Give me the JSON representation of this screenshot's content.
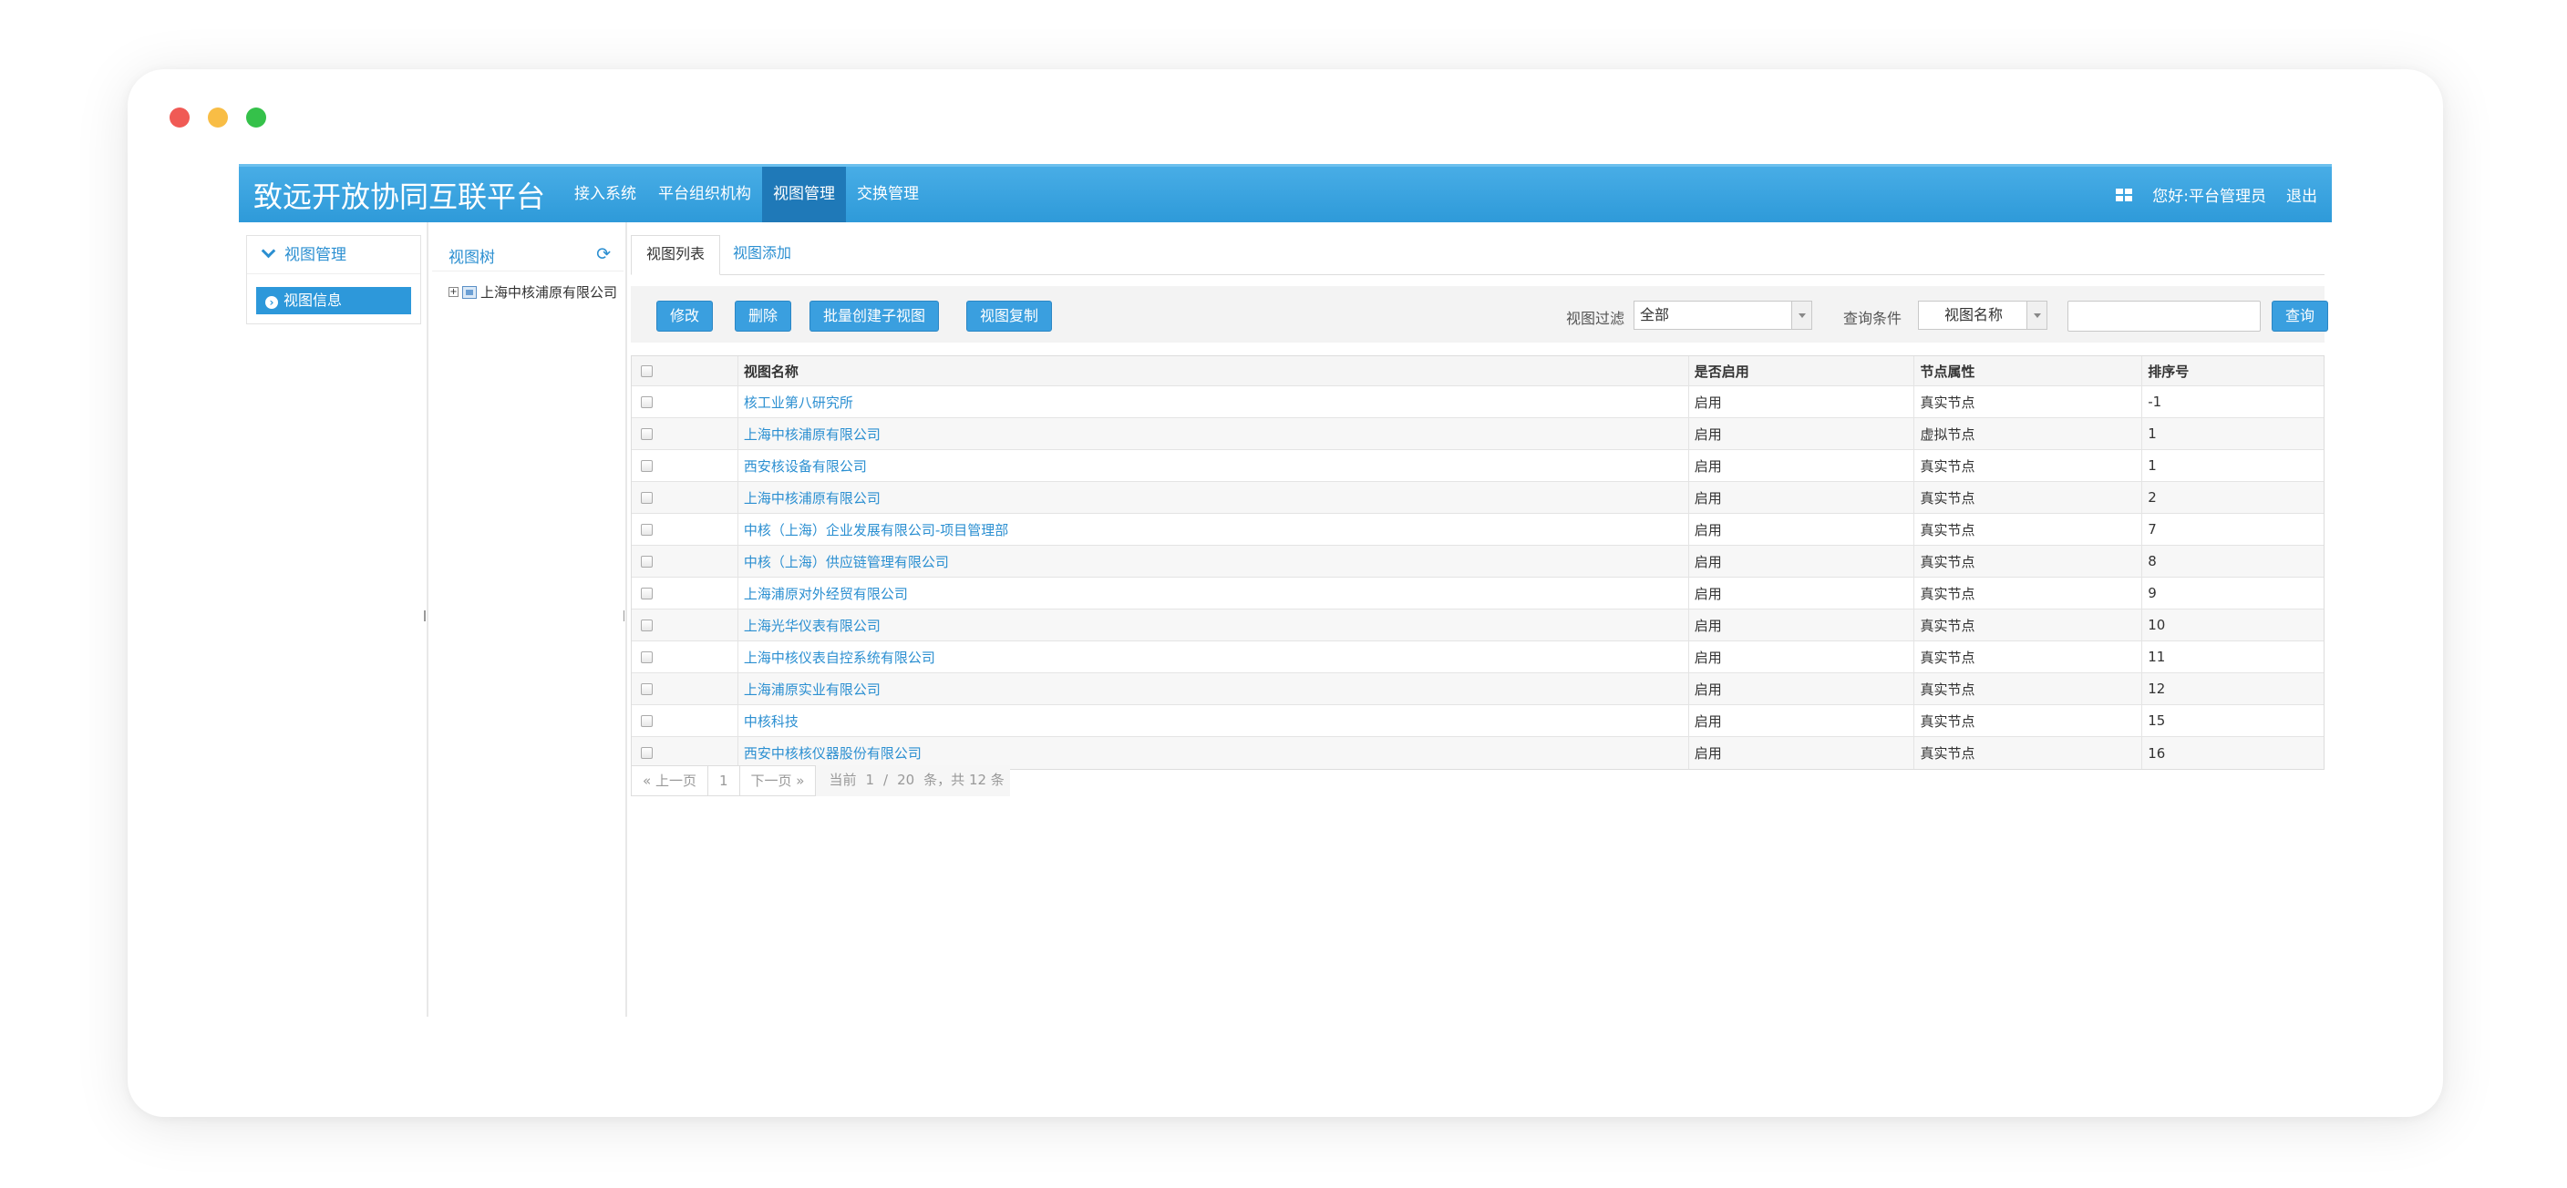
{
  "brand": "致远开放协同互联平台",
  "nav": [
    {
      "label": "接入系统"
    },
    {
      "label": "平台组织机构"
    },
    {
      "label": "视图管理",
      "active": true
    },
    {
      "label": "交换管理"
    }
  ],
  "user": {
    "greeting": "您好:平台管理员",
    "logout": "退出"
  },
  "leftmenu": {
    "title": "视图管理",
    "item": "视图信息"
  },
  "tree": {
    "title": "视图树",
    "node": "上海中核浦原有限公司"
  },
  "tabs": {
    "list": "视图列表",
    "add": "视图添加"
  },
  "toolbar": {
    "edit": "修改",
    "delete": "删除",
    "batch_create": "批量创建子视图",
    "copy": "视图复制",
    "filter_label": "视图过滤",
    "filter_value": "全部",
    "query_label": "查询条件",
    "query_value": "视图名称",
    "search_value": "",
    "search_button": "查询"
  },
  "table": {
    "headers": [
      "视图名称",
      "是否启用",
      "节点属性",
      "排序号"
    ],
    "rows": [
      {
        "name": "核工业第八研究所",
        "enabled": "启用",
        "node_type": "真实节点",
        "order": "-1"
      },
      {
        "name": "上海中核浦原有限公司",
        "enabled": "启用",
        "node_type": "虚拟节点",
        "order": "1"
      },
      {
        "name": "西安核设备有限公司",
        "enabled": "启用",
        "node_type": "真实节点",
        "order": "1"
      },
      {
        "name": "上海中核浦原有限公司",
        "enabled": "启用",
        "node_type": "真实节点",
        "order": "2"
      },
      {
        "name": "中核（上海）企业发展有限公司-项目管理部",
        "enabled": "启用",
        "node_type": "真实节点",
        "order": "7"
      },
      {
        "name": "中核（上海）供应链管理有限公司",
        "enabled": "启用",
        "node_type": "真实节点",
        "order": "8"
      },
      {
        "name": "上海浦原对外经贸有限公司",
        "enabled": "启用",
        "node_type": "真实节点",
        "order": "9"
      },
      {
        "name": "上海光华仪表有限公司",
        "enabled": "启用",
        "node_type": "真实节点",
        "order": "10"
      },
      {
        "name": "上海中核仪表自控系统有限公司",
        "enabled": "启用",
        "node_type": "真实节点",
        "order": "11"
      },
      {
        "name": "上海浦原实业有限公司",
        "enabled": "启用",
        "node_type": "真实节点",
        "order": "12"
      },
      {
        "name": "中核科技",
        "enabled": "启用",
        "node_type": "真实节点",
        "order": "15"
      },
      {
        "name": "西安中核核仪器股份有限公司",
        "enabled": "启用",
        "node_type": "真实节点",
        "order": "16"
      }
    ]
  },
  "pager": {
    "prev": "« 上一页",
    "page": "1",
    "next": "下一页 »",
    "current_label": "当前",
    "current": "1",
    "sep": "/",
    "page_size": "20",
    "summary": "条，共 12 条"
  }
}
